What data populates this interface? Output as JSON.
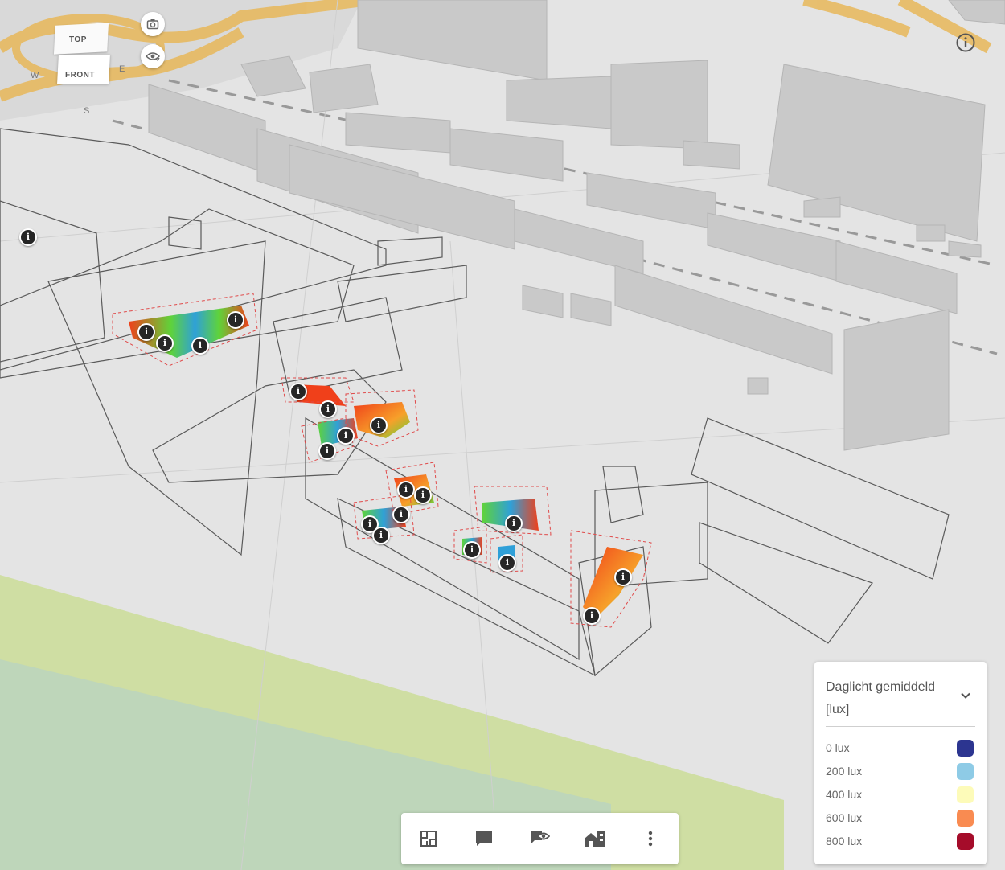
{
  "view_cube": {
    "top_label": "TOP",
    "front_label": "FRONT",
    "compass": {
      "west": "W",
      "east": "E",
      "south": "S"
    }
  },
  "controls": {
    "camera_icon": "camera-icon",
    "visibility_icon": "eye-icon",
    "info_icon": "info-icon"
  },
  "map": {
    "marker_glyph": "i",
    "marker_count": 20
  },
  "legend": {
    "title": "Daglicht gemiddeld [lux]",
    "items": [
      {
        "label": "0 lux",
        "color": "#2c3590"
      },
      {
        "label": "200 lux",
        "color": "#8ecbe6"
      },
      {
        "label": "400 lux",
        "color": "#fdfbb9"
      },
      {
        "label": "600 lux",
        "color": "#f98b51"
      },
      {
        "label": "800 lux",
        "color": "#a50c2a"
      }
    ]
  },
  "toolbar": {
    "buttons": [
      {
        "icon": "floorplan-icon"
      },
      {
        "icon": "comment-icon"
      },
      {
        "icon": "comment-view-icon"
      },
      {
        "icon": "buildings-icon"
      },
      {
        "icon": "more-vertical-icon"
      }
    ]
  },
  "colors": {
    "ground": "#e6e6e6",
    "building": "#c9c9c9",
    "road": "#e8b85a",
    "green_area": "#cfdea3",
    "outline": "#555555",
    "heat_low": "#2fa0d8",
    "heat_mid": "#5fd33a",
    "heat_high": "#f0401a"
  }
}
